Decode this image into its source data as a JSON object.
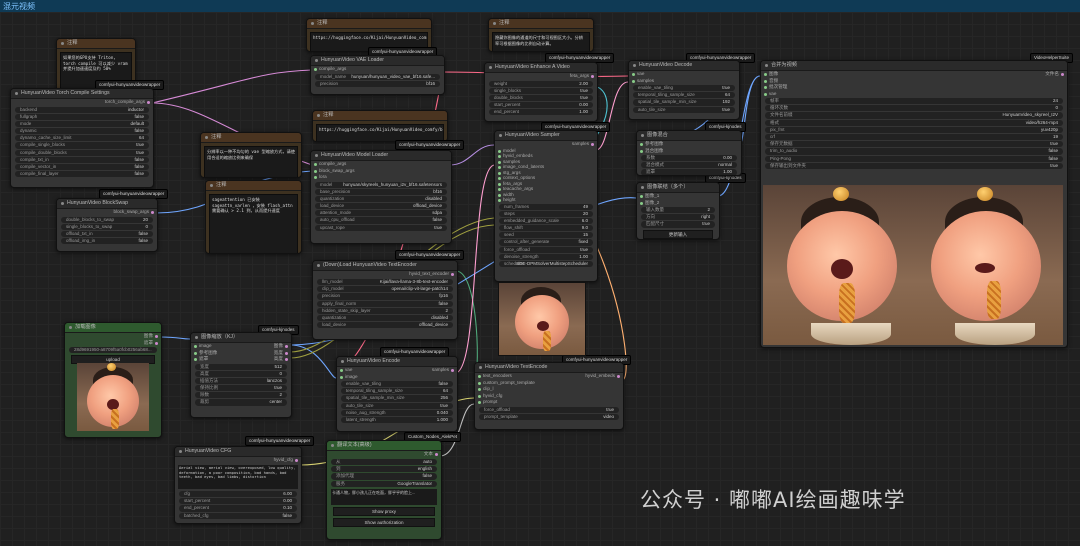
{
  "window_title": "混元视频",
  "watermark": "公众号 · 嘟嘟AI绘画趣味学",
  "colors": {
    "canvas": "#202020",
    "node": "#353535",
    "note": "#3d3120",
    "green_group": "#2f4a2f"
  },
  "notes": {
    "note1": {
      "title": "注释",
      "text": "如果您的GPU支持 Triton，torch compile 可以减少 vram 并提升加速速度及约 50%"
    },
    "note2": {
      "title": "注释",
      "text": "https://huggingface.co/Kijai/HunyuanVideo_comfy/blob/main/hunyuan_video_vae_bf16.safetensors"
    },
    "note3": {
      "title": "注释",
      "text": "https://huggingface.co/Kijai/HunyuanVideo_comfy/blob/main/hunyuan_video_720_cfgdistill_fp8_e4m3fn.safetensors"
    },
    "note4": {
      "title": "注释",
      "text": "隐藏你图像的通道的尺寸和可视图区大小。分辨率可根据图像的比例自动计算。"
    },
    "note5": {
      "title": "注释",
      "text": "分辨率以一种不均匀的 vae 型缩放方式，请使用合适的缩放比例来确保"
    },
    "note6": {
      "title": "注释",
      "text": "sageattention 已安装 sageattn_varlen ，安装 flash_attn 需要确认 > 2.1 到，从而提升速度"
    }
  },
  "badges": [
    "comfyui-hunyuanvideowrapper",
    "comfyui-kjnodes",
    "Custom_Nodes_AlekPet",
    "VideoHelperSuite"
  ],
  "nodes": {
    "torch_compile": {
      "title": "HunyuanVideo Torch Compile Settings",
      "out": "torch_compile_args",
      "widgets": [
        [
          "backend",
          "inductor"
        ],
        [
          "fullgraph",
          "false"
        ],
        [
          "mode",
          "default"
        ],
        [
          "dynamic",
          "false"
        ],
        [
          "dynamo_cache_size_limit",
          "64"
        ],
        [
          "compile_single_blocks",
          "true"
        ],
        [
          "compile_double_blocks",
          "true"
        ],
        [
          "compile_txt_in",
          "false"
        ],
        [
          "compile_vector_in",
          "false"
        ],
        [
          "compile_final_layer",
          "false"
        ]
      ]
    },
    "blockswap": {
      "title": "HunyuanVideo BlockSwap",
      "out": "block_swap_args",
      "widgets": [
        [
          "double_blocks_to_swap",
          "20"
        ],
        [
          "single_blocks_to_swap",
          "0"
        ],
        [
          "offload_txt_in",
          "false"
        ],
        [
          "offload_img_in",
          "false"
        ]
      ]
    },
    "vae_loader": {
      "title": "HunyuanVideo VAE Loader",
      "in": [
        "compile_args"
      ],
      "out": "vae",
      "widgets": [
        [
          "model_name",
          "hunyuan/hunyuan_video_vae_bf16.safe..."
        ],
        [
          "precision",
          "bf16"
        ]
      ]
    },
    "model_loader": {
      "title": "HunyuanVideo Model Loader",
      "in": [
        "compile_args",
        "block_swap_args",
        "lora"
      ],
      "out": "model",
      "widgets": [
        [
          "model",
          "hunyuan/skyreels_hunyuan_i2v_bf16.safetensors"
        ],
        [
          "base_precision",
          "bf16"
        ],
        [
          "quantization",
          "disabled"
        ],
        [
          "load_device",
          "offload_device"
        ],
        [
          "attention_mode",
          "sdpa"
        ],
        [
          "auto_cpu_offload",
          "false"
        ],
        [
          "upcast_rope",
          "true"
        ]
      ]
    },
    "enhance": {
      "title": "HunyuanVideo Enhance A Video",
      "out": "feta_args",
      "widgets": [
        [
          "weight",
          "2.00"
        ],
        [
          "single_blocks",
          "true"
        ],
        [
          "double_blocks",
          "true"
        ],
        [
          "start_percent",
          "0.00"
        ],
        [
          "end_percent",
          "1.00"
        ]
      ]
    },
    "sampler": {
      "title": "HunyuanVideo Sampler",
      "out": "samples",
      "in": [
        "model",
        "hyvid_embeds",
        "samples",
        "image_cond_latents",
        "stg_args",
        "context_options",
        "feta_args",
        "teacache_args"
      ],
      "sock2": [
        "width",
        "height"
      ],
      "widgets": [
        [
          "num_frames",
          "49"
        ],
        [
          "steps",
          "20"
        ],
        [
          "embedded_guidance_scale",
          "6.0"
        ],
        [
          "flow_shift",
          "9.0"
        ],
        [
          "seed",
          "15"
        ],
        [
          "control_after_generate",
          "fixed"
        ],
        [
          "force_offload",
          "true"
        ],
        [
          "denoise_strength",
          "1.00"
        ],
        [
          "scheduler",
          "SDE-DPMSolverMultistepScheduler"
        ]
      ]
    },
    "decode": {
      "title": "HunyuanVideo Decode",
      "in": [
        "vae",
        "samples"
      ],
      "out": "images",
      "widgets": [
        [
          "enable_vae_tiling",
          "true"
        ],
        [
          "temporal_tiling_sample_size",
          "64"
        ],
        [
          "spatial_tile_sample_min_size",
          "192"
        ],
        [
          "auto_tile_size",
          "true"
        ]
      ]
    },
    "img_blend": {
      "title": "图像混合",
      "in": [
        "参考图像",
        "混合图像"
      ],
      "out": "图像",
      "widgets": [
        [
          "系数",
          "0.00"
        ],
        [
          "混合模式",
          "normal"
        ],
        [
          "遮罩",
          "1.00"
        ]
      ]
    },
    "img_concat": {
      "title": "图像联结（多个）",
      "in": [
        "图像_1",
        "图像_2"
      ],
      "out": "图像",
      "widgets": [
        [
          "输入数量",
          "2"
        ],
        [
          "方向",
          "right"
        ],
        [
          "匹配尺寸",
          "true"
        ]
      ],
      "btn": "更新输入"
    },
    "combine": {
      "title": "合并为视频",
      "in": [
        "图像",
        "音频",
        "批次管理",
        "vae"
      ],
      "out": "文件名",
      "widgets": [
        [
          "帧率",
          "24"
        ],
        [
          "循环次数",
          "0"
        ],
        [
          "文件名前缀",
          "HunyuanVideo_skyreel_I2V"
        ],
        [
          "格式",
          "video/h264-mp4"
        ],
        [
          "pix_fmt",
          "yuv420p"
        ],
        [
          "crf",
          "19"
        ],
        [
          "保存元数据",
          "true"
        ],
        [
          "trim_to_audio",
          "false"
        ],
        [
          "Ping-Pong",
          "false"
        ],
        [
          "保存输出到文件夹",
          "true"
        ]
      ]
    },
    "text_encoder": {
      "title": "(Down)Load HunyuanVideo TextEncoder",
      "out": "hyvid_text_encoder",
      "widgets": [
        [
          "llm_model",
          "Kijai/llava-llama-3-8b-text-encoder"
        ],
        [
          "clip_model",
          "openai/clip-vit-large-patch14"
        ],
        [
          "precision",
          "fp16"
        ],
        [
          "apply_final_norm",
          "false"
        ],
        [
          "hidden_state_skip_layer",
          "2"
        ],
        [
          "quantization",
          "disabled"
        ],
        [
          "load_device",
          "offload_device"
        ]
      ]
    },
    "encode": {
      "title": "HunyuanVideo Encode",
      "in": [
        "vae",
        "image"
      ],
      "out": "samples",
      "widgets": [
        [
          "enable_vae_tiling",
          "false"
        ],
        [
          "temporal_tiling_sample_size",
          "64"
        ],
        [
          "spatial_tile_sample_min_size",
          "256"
        ],
        [
          "auto_tile_size",
          "true"
        ],
        [
          "noise_aug_strength",
          "0.040"
        ],
        [
          "latent_strength",
          "1.000"
        ]
      ]
    },
    "text_encode": {
      "title": "HunyuanVideo TextEncode",
      "in": [
        "text_encoders",
        "custom_prompt_template",
        "clip_l",
        "hyvid_cfg",
        "prompt"
      ],
      "out": "hyvid_embeds",
      "widgets": [
        [
          "force_offload",
          "true"
        ],
        [
          "prompt_template",
          "video"
        ]
      ]
    },
    "load_image": {
      "title": "加载图像",
      "out": [
        "图像",
        "遮罩"
      ],
      "file": "28d9691950-a8709f5a0fcb0256ab68...",
      "btn": "upload"
    },
    "resize": {
      "title": "图像缩放（KJ）",
      "in": [
        "image",
        "参考图像",
        "遮罩"
      ],
      "out": [
        "图像",
        "宽度",
        "高度"
      ],
      "widgets": [
        [
          "宽度",
          "512"
        ],
        [
          "高度",
          "0"
        ],
        [
          "插值方法",
          "lanczos"
        ],
        [
          "保持比例",
          "true"
        ],
        [
          "除数",
          "2"
        ],
        [
          "裁剪",
          "center"
        ]
      ]
    },
    "cfg": {
      "title": "HunyuanVideo CFG",
      "out": "hyvid_cfg",
      "text": "Aerial view, aerial view, overexposed, low quality, deformation, a poor composition, bad hands, bad teeth, bad eyes, bad limbs, distortion",
      "widgets": [
        [
          "cfg",
          "6.00"
        ],
        [
          "start_percent",
          "0.00"
        ],
        [
          "end_percent",
          "0.10"
        ],
        [
          "batched_cfg",
          "false"
        ]
      ]
    },
    "translate": {
      "title": "翻译文本(高级)",
      "out": "文本",
      "widgets": [
        [
          "从",
          "auto"
        ],
        [
          "到",
          "english"
        ],
        [
          "添加代理",
          "false"
        ],
        [
          "服务",
          "GoogleTranslator"
        ]
      ],
      "text": "卡通人物，胖小孩儿正在吃面，胖乎乎的脸上...",
      "btns": [
        "Show proxy",
        "Show authorization"
      ]
    }
  }
}
